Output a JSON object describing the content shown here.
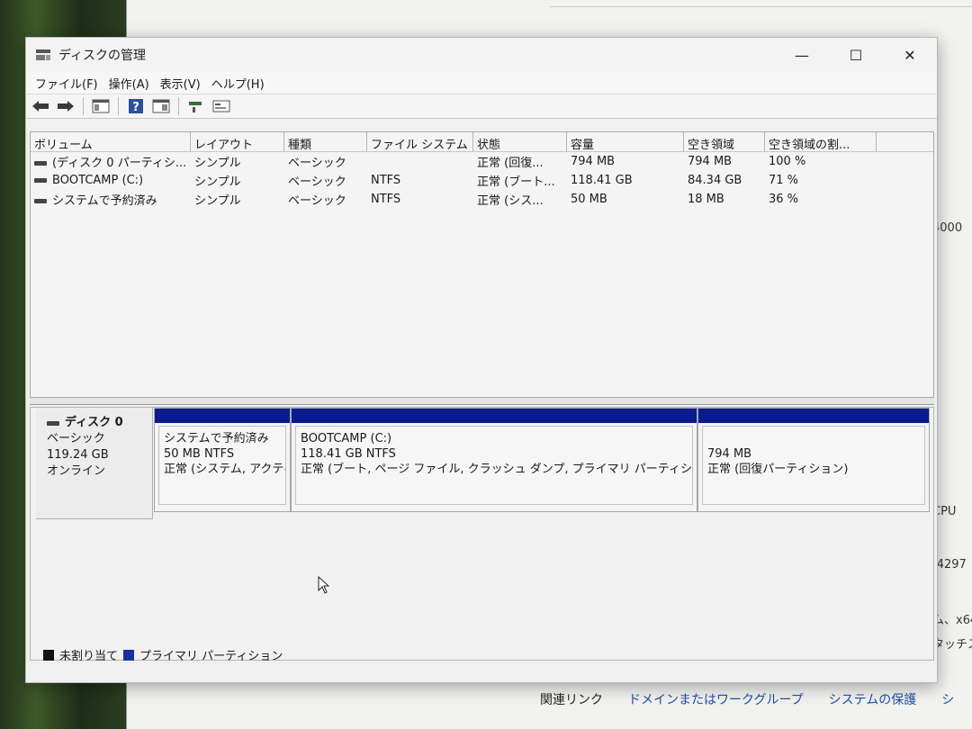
{
  "background_window": {
    "side_text": [
      "4000",
      "CPU",
      "-4297",
      "ム、x64",
      "タッチス"
    ],
    "links_title": "関連リンク",
    "links": [
      "ドメインまたはワークグループ",
      "システムの保護",
      "シ"
    ]
  },
  "window": {
    "title": "ディスクの管理",
    "controls": {
      "minimize": "—",
      "maximize": "☐",
      "close": "✕"
    }
  },
  "menu": [
    "ファイル(F)",
    "操作(A)",
    "表示(V)",
    "ヘルプ(H)"
  ],
  "volume_list": {
    "columns": [
      "ボリューム",
      "レイアウト",
      "種類",
      "ファイル システム",
      "状態",
      "容量",
      "空き領域",
      "空き領域の割..."
    ],
    "rows": [
      {
        "volume": "(ディスク 0 パーティシ...",
        "layout": "シンプル",
        "type": "ベーシック",
        "fs": "",
        "status": "正常 (回復...",
        "capacity": "794 MB",
        "free": "794 MB",
        "pct": "100 %"
      },
      {
        "volume": "BOOTCAMP (C:)",
        "layout": "シンプル",
        "type": "ベーシック",
        "fs": "NTFS",
        "status": "正常 (ブート...",
        "capacity": "118.41 GB",
        "free": "84.34 GB",
        "pct": "71 %"
      },
      {
        "volume": "システムで予約済み",
        "layout": "シンプル",
        "type": "ベーシック",
        "fs": "NTFS",
        "status": "正常 (シス...",
        "capacity": "50 MB",
        "free": "18 MB",
        "pct": "36 %"
      }
    ]
  },
  "disk": {
    "name": "ディスク 0",
    "type": "ベーシック",
    "size": "119.24 GB",
    "state": "オンライン",
    "partitions": [
      {
        "name": "システムで予約済み",
        "size": "50 MB NTFS",
        "status": "正常 (システム, アクティ"
      },
      {
        "name": "BOOTCAMP  (C:)",
        "size": "118.41 GB NTFS",
        "status": "正常 (ブート, ページ ファイル, クラッシュ ダンプ, プライマリ パーティション)"
      },
      {
        "name": "",
        "size": "794 MB",
        "status": "正常 (回復パーティション)"
      }
    ]
  },
  "legend": [
    {
      "label": "未割り当て",
      "color": "#111111"
    },
    {
      "label": "プライマリ パーティション",
      "color": "#1a2f9c"
    }
  ],
  "colors": {
    "partition_band": "#0a1b8e"
  }
}
